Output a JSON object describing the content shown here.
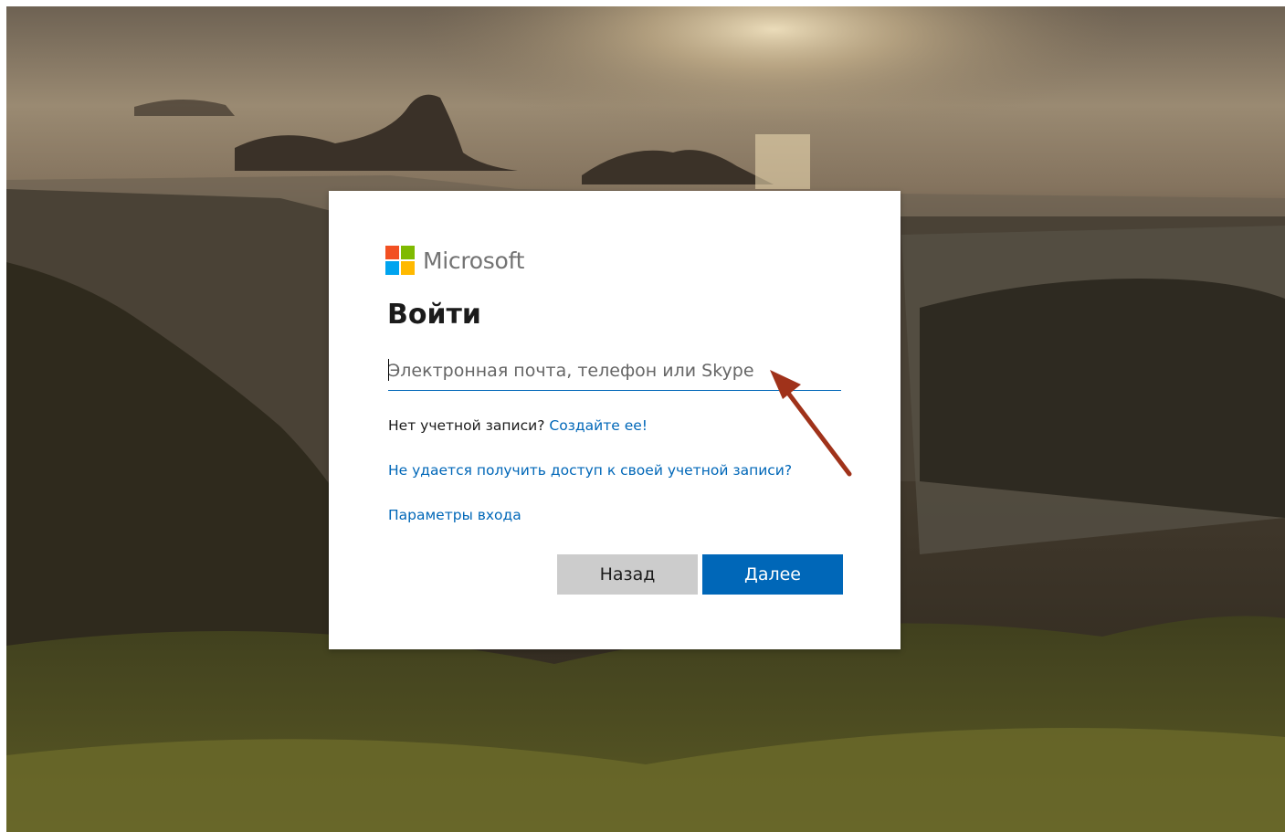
{
  "logo": {
    "text": "Microsoft",
    "colors": [
      "#f25022",
      "#7fba00",
      "#00a4ef",
      "#ffb900"
    ]
  },
  "signin": {
    "title": "Войти",
    "email_placeholder": "Электронная почта, телефон или Skype",
    "no_account_text": "Нет учетной записи?",
    "create_link": "Создайте ее!",
    "cant_access_link": "Не удается получить доступ к своей учетной записи?",
    "signin_options_link": "Параметры входа",
    "back_button": "Назад",
    "next_button": "Далее"
  },
  "annotation": {
    "arrow_color": "#a0321a"
  },
  "colors": {
    "accent": "#0067b8",
    "back_button_bg": "#cccccc"
  }
}
